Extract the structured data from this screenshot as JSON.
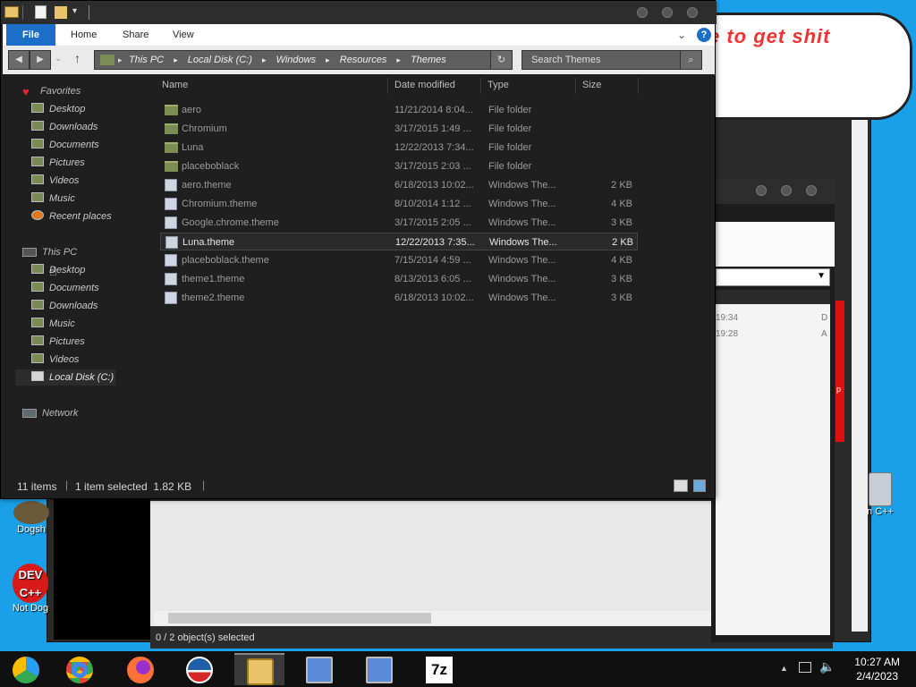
{
  "background": {
    "speech_text": "e to get shit",
    "mid_times": [
      "19:34",
      "19:28"
    ],
    "mid_letters": [
      "D",
      "A"
    ],
    "status": "0 / 2 object(s) selected",
    "desktop_icons": [
      {
        "name": "dogs-icon",
        "label": "Dogsh"
      },
      {
        "name": "dev-cpp-icon",
        "label": "Not Dog"
      },
      {
        "name": "recycle-bin-icon",
        "label": "n C++"
      }
    ],
    "red_bar_text": "p"
  },
  "explorer": {
    "ribbon_tabs": [
      "File",
      "Home",
      "Share",
      "View"
    ],
    "breadcrumb": [
      "This PC",
      "Local Disk (C:)",
      "Windows",
      "Resources",
      "Themes"
    ],
    "search_placeholder": "Search Themes",
    "nav": {
      "favorites": {
        "label": "Favorites",
        "items": [
          "Desktop",
          "Downloads",
          "Documents",
          "Pictures",
          "Videos",
          "Music",
          "Recent places"
        ]
      },
      "this_pc": {
        "label": "This PC",
        "items": [
          "Desktop",
          "Documents",
          "Downloads",
          "Music",
          "Pictures",
          "Videos",
          "Local Disk (C:)"
        ]
      },
      "network": "Network"
    },
    "columns": [
      "Name",
      "Date modified",
      "Type",
      "Size"
    ],
    "files": [
      {
        "name": "aero",
        "date": "11/21/2014 8:04...",
        "type": "File folder",
        "size": "",
        "kind": "folder"
      },
      {
        "name": "Chromium",
        "date": "3/17/2015 1:49 ...",
        "type": "File folder",
        "size": "",
        "kind": "folder"
      },
      {
        "name": "Luna",
        "date": "12/22/2013 7:34...",
        "type": "File folder",
        "size": "",
        "kind": "folder"
      },
      {
        "name": "placeboblack",
        "date": "3/17/2015 2:03 ...",
        "type": "File folder",
        "size": "",
        "kind": "folder"
      },
      {
        "name": "aero.theme",
        "date": "6/18/2013 10:02...",
        "type": "Windows The...",
        "size": "2 KB",
        "kind": "file"
      },
      {
        "name": "Chromium.theme",
        "date": "8/10/2014 1:12 ...",
        "type": "Windows The...",
        "size": "4 KB",
        "kind": "file"
      },
      {
        "name": "Google.chrome.theme",
        "date": "3/17/2015 2:05 ...",
        "type": "Windows The...",
        "size": "3 KB",
        "kind": "file"
      },
      {
        "name": "Luna.theme",
        "date": "12/22/2013 7:35...",
        "type": "Windows The...",
        "size": "2 KB",
        "kind": "file",
        "selected": true
      },
      {
        "name": "placeboblack.theme",
        "date": "7/15/2014 4:59 ...",
        "type": "Windows The...",
        "size": "4 KB",
        "kind": "file"
      },
      {
        "name": "theme1.theme",
        "date": "8/13/2013 6:05 ...",
        "type": "Windows The...",
        "size": "3 KB",
        "kind": "file"
      },
      {
        "name": "theme2.theme",
        "date": "6/18/2013 10:02...",
        "type": "Windows The...",
        "size": "3 KB",
        "kind": "file"
      }
    ],
    "status": {
      "count": "11 items",
      "selected": "1 item selected  1.82 KB"
    }
  },
  "taskbar": {
    "apps": [
      "chrome-alt-icon",
      "chrome-icon",
      "firefox-icon",
      "obama-logo-icon",
      "file-explorer-icon",
      "installer-icon",
      "installer-icon-2",
      "7zip-icon"
    ],
    "seven_zip_label": "7z",
    "time": "10:27 AM",
    "date": "2/4/2023"
  },
  "colors": {
    "accent": "#1c6fc9",
    "desktop": "#1aa0e8",
    "folder": "#7b8d54"
  }
}
